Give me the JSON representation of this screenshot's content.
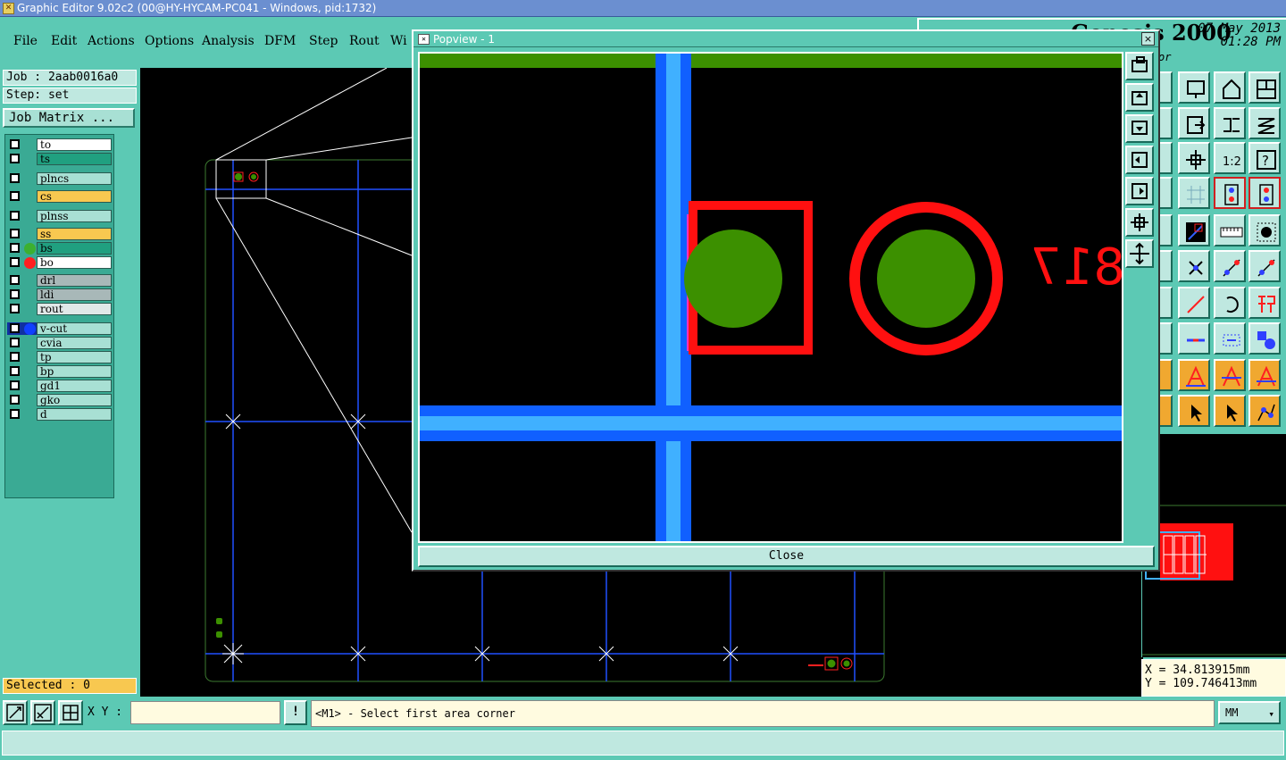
{
  "window": {
    "title": "Graphic Editor 9.02c2 (00@HY-HYCAM-PC041 - Windows, pid:1732)"
  },
  "menu": [
    "File",
    "Edit",
    "Actions",
    "Options",
    "Analysis",
    "DFM",
    "Step",
    "Rout",
    "Wi"
  ],
  "header": {
    "app_name": "Genesis 2000",
    "date": "07 May 2013",
    "time": "01:28 PM",
    "sub": "or"
  },
  "job": {
    "job_label": "Job : 2aab0016a0",
    "step_label": "Step: set",
    "matrix_button": "Job Matrix ..."
  },
  "layers": [
    {
      "name": "to",
      "color": "#ffffff",
      "dot": ""
    },
    {
      "name": "ts",
      "color": "#20a080",
      "dot": ""
    },
    {
      "name": "plncs",
      "color": "#a8e0d4",
      "dot": ""
    },
    {
      "name": "cs",
      "color": "#f8c850",
      "dot": ""
    },
    {
      "name": "plnss",
      "color": "#a8e0d4",
      "dot": ""
    },
    {
      "name": "ss",
      "color": "#f8c850",
      "dot": ""
    },
    {
      "name": "bs",
      "color": "#20a080",
      "dot": "#3cb030"
    },
    {
      "name": "bo",
      "color": "#ffffff",
      "dot": "#ff2020"
    },
    {
      "name": "drl",
      "color": "#a8b8b8",
      "dot": ""
    },
    {
      "name": "ldi",
      "color": "#a8b8b8",
      "dot": ""
    },
    {
      "name": "rout",
      "color": "#e0e8e8",
      "dot": ""
    },
    {
      "name": "v-cut",
      "color": "#a8e0d4",
      "dot": "#1040ff"
    },
    {
      "name": "cvia",
      "color": "#a8e0d4",
      "dot": ""
    },
    {
      "name": "tp",
      "color": "#a8e0d4",
      "dot": ""
    },
    {
      "name": "bp",
      "color": "#a8e0d4",
      "dot": ""
    },
    {
      "name": "gd1",
      "color": "#a8e0d4",
      "dot": ""
    },
    {
      "name": "gko",
      "color": "#a8e0d4",
      "dot": ""
    },
    {
      "name": "d",
      "color": "#a8e0d4",
      "dot": ""
    }
  ],
  "selected": "Selected : 0",
  "popup": {
    "title": "Popview - 1",
    "close_x": "×",
    "close_label": "Close",
    "silk_text": "817"
  },
  "coords": {
    "x": "X = 34.813915mm",
    "y": "Y = 109.746413mm"
  },
  "bottom": {
    "xy_label": "X Y :",
    "xy_value": "",
    "alert": "!",
    "prompt": "<M1> - Select first area corner",
    "units": "MM",
    "units_arrow": "▾"
  },
  "colors": {
    "background": "#5cc9b4",
    "pad_green": "#3c9000",
    "pad_red": "#ff1010",
    "vcut_blue": "#1060ff",
    "vcut_light": "#40b0ff",
    "outline": "#3c7a30"
  }
}
